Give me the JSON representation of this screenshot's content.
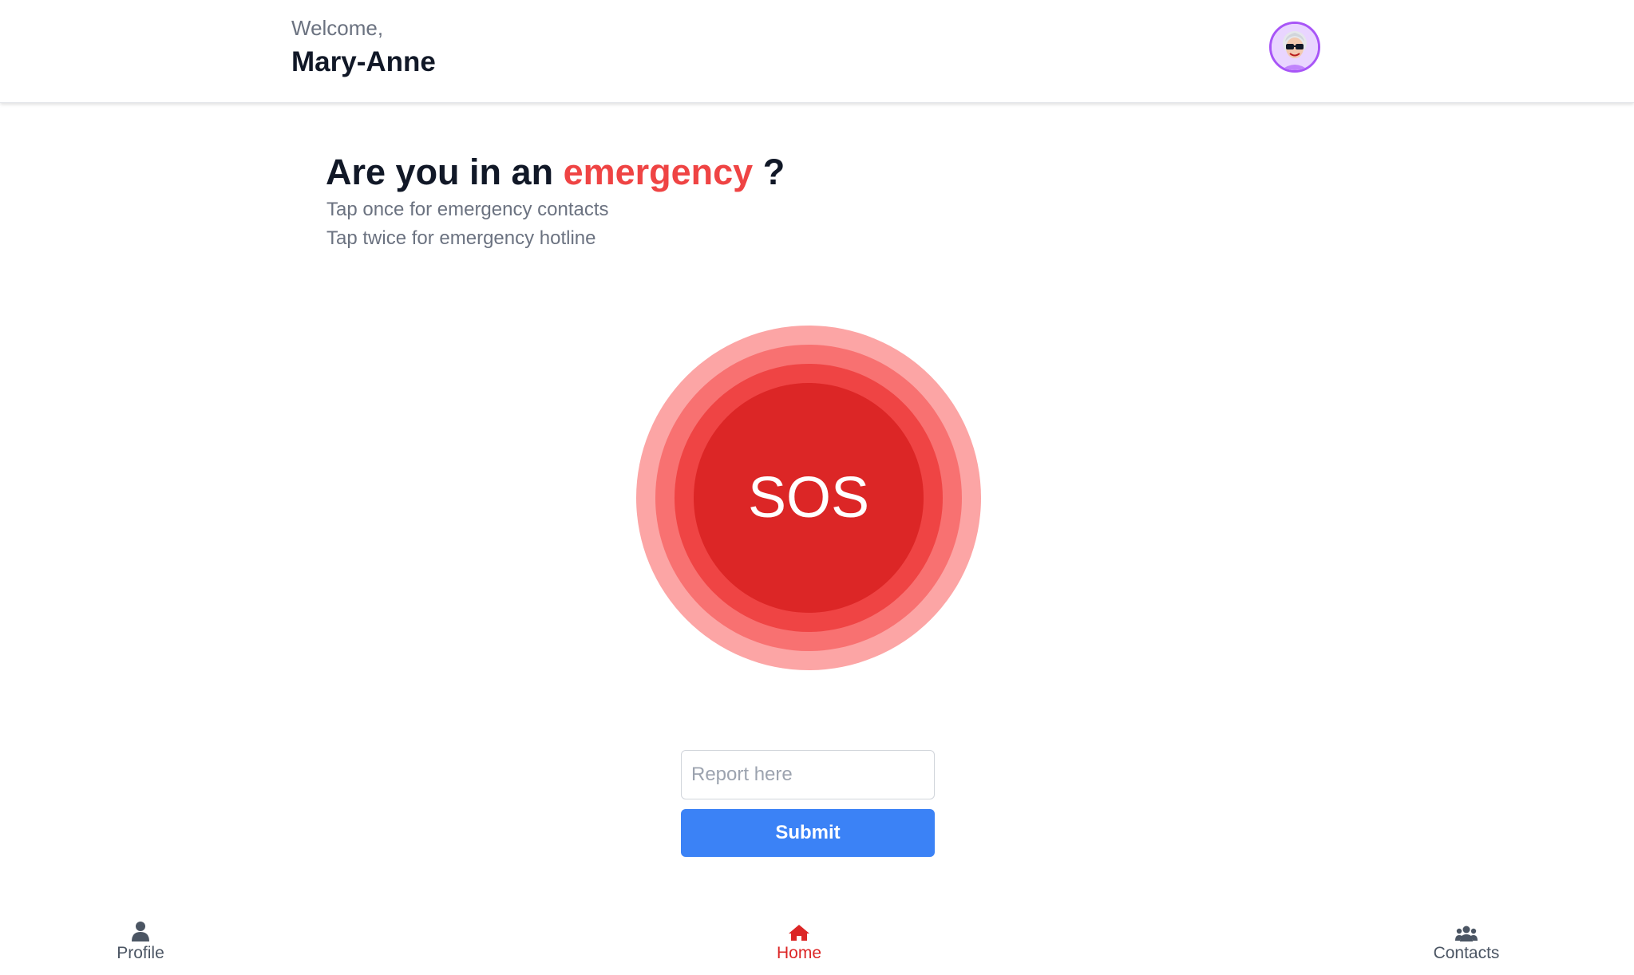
{
  "header": {
    "greeting": "Welcome,",
    "user_name": "Mary-Anne",
    "avatar_icon": "user-avatar-photo"
  },
  "main": {
    "headline_prefix": "Are you in an ",
    "headline_emphasis": "emergency",
    "headline_suffix": " ?",
    "instruction_once": "Tap once for emergency contacts",
    "instruction_twice": "Tap twice for emergency hotline",
    "sos_label": "SOS"
  },
  "report": {
    "placeholder": "Report here",
    "value": "",
    "submit_label": "Submit"
  },
  "bottom_nav": {
    "profile": {
      "label": "Profile",
      "icon": "user-icon"
    },
    "home": {
      "label": "Home",
      "icon": "home-icon",
      "active": true
    },
    "contacts": {
      "label": "Contacts",
      "icon": "users-icon"
    }
  },
  "colors": {
    "accent": "#ef4444",
    "sos_core": "#dc2626",
    "submit": "#3b82f6",
    "avatar_ring": "#a855f7",
    "nav_active": "#dc2626",
    "nav_inactive": "#4b5563"
  }
}
